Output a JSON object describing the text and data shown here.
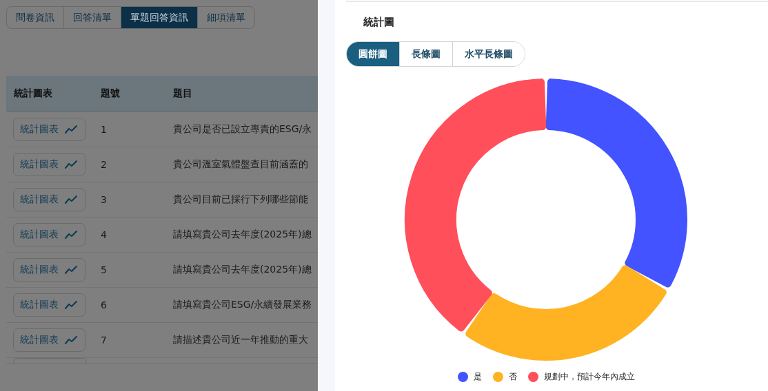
{
  "page_tabs": [
    {
      "label": "問卷資訊",
      "selected": false
    },
    {
      "label": "回答清單",
      "selected": false
    },
    {
      "label": "單題回答資訊",
      "selected": true
    },
    {
      "label": "細項清單",
      "selected": false
    }
  ],
  "table": {
    "columns": [
      "統計圖表",
      "題號",
      "題目"
    ],
    "rows": [
      {
        "button": "統計圖表",
        "number": "1",
        "question": "貴公司是否已設立專責的ESG/永"
      },
      {
        "button": "統計圖表",
        "number": "2",
        "question": "貴公司溫室氣體盤查目前涵蓋的"
      },
      {
        "button": "統計圖表",
        "number": "3",
        "question": "貴公司目前已採行下列哪些節能"
      },
      {
        "button": "統計圖表",
        "number": "4",
        "question": "請填寫貴公司去年度(2025年)總"
      },
      {
        "button": "統計圖表",
        "number": "5",
        "question": "請填寫貴公司去年度(2025年)總"
      },
      {
        "button": "統計圖表",
        "number": "6",
        "question": "請填寫貴公司ESG/永續發展業務"
      },
      {
        "button": "統計圖表",
        "number": "7",
        "question": "請描述貴公司近一年推動的重大"
      }
    ]
  },
  "drawer": {
    "title": "統計圖",
    "chart_tabs": [
      {
        "label": "圓餅圖",
        "selected": true
      },
      {
        "label": "長條圖",
        "selected": false
      },
      {
        "label": "水平長條圖",
        "selected": false
      }
    ],
    "chart_data": {
      "type": "donut",
      "categories": [
        "是",
        "否",
        "規劃中，預計今年內成立"
      ],
      "values": [
        33.3,
        26.7,
        40
      ],
      "colors": [
        "#4353ff",
        "#ffb323",
        "#ff4f5a"
      ]
    }
  }
}
